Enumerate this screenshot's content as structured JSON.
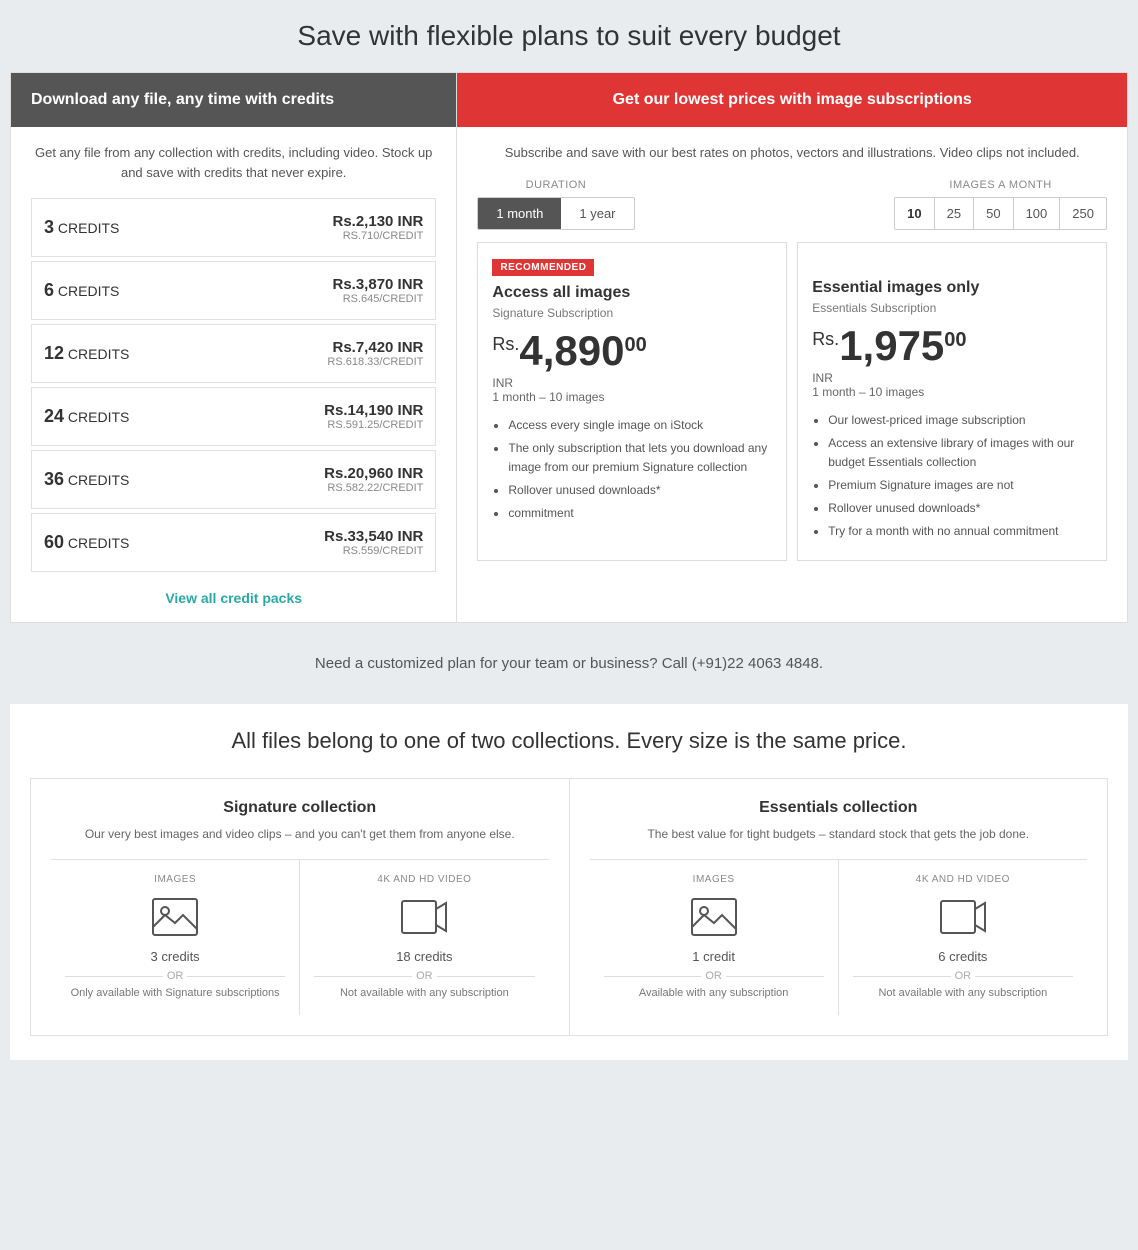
{
  "page": {
    "main_title": "Save with flexible plans to suit every budget"
  },
  "credits_panel": {
    "header": "Download any file, any time with credits",
    "description": "Get any file from any collection with credits, including video. Stock up and save with credits that never expire.",
    "rows": [
      {
        "count": "3",
        "label": "CREDITS",
        "price": "Rs.2,130 INR",
        "per_credit": "RS.710/CREDIT"
      },
      {
        "count": "6",
        "label": "CREDITS",
        "price": "Rs.3,870 INR",
        "per_credit": "RS.645/CREDIT"
      },
      {
        "count": "12",
        "label": "CREDITS",
        "price": "Rs.7,420 INR",
        "per_credit": "RS.618.33/CREDIT"
      },
      {
        "count": "24",
        "label": "CREDITS",
        "price": "Rs.14,190 INR",
        "per_credit": "RS.591.25/CREDIT"
      },
      {
        "count": "36",
        "label": "CREDITS",
        "price": "Rs.20,960 INR",
        "per_credit": "RS.582.22/CREDIT"
      },
      {
        "count": "60",
        "label": "CREDITS",
        "price": "Rs.33,540 INR",
        "per_credit": "RS.559/CREDIT"
      }
    ],
    "view_all_link": "View all credit packs"
  },
  "subs_panel": {
    "header": "Get our lowest prices with image subscriptions",
    "description": "Subscribe and save with our best rates on photos, vectors and illustrations. Video clips not included.",
    "duration_label": "DURATION",
    "duration_options": [
      "1 month",
      "1 year"
    ],
    "duration_active": "1 month",
    "images_label": "IMAGES A MONTH",
    "images_options": [
      "10",
      "25",
      "50",
      "100",
      "250"
    ],
    "images_active": "10",
    "cards": [
      {
        "recommended": true,
        "recommended_label": "RECOMMENDED",
        "title": "Access all images",
        "subtitle": "Signature Subscription",
        "price_rs": "Rs.",
        "price_main": "4,890",
        "price_decimal": "00",
        "price_currency": "INR",
        "price_duration": "1 month – 10 images",
        "features": [
          "Access every single image on iStock",
          "The only subscription that lets you download any image from our premium Signature collection",
          "Rollover unused downloads*",
          "commitment"
        ]
      },
      {
        "recommended": false,
        "title": "Essential images only",
        "subtitle": "Essentials Subscription",
        "price_rs": "Rs.",
        "price_main": "1,975",
        "price_decimal": "00",
        "price_currency": "INR",
        "price_duration": "1 month – 10 images",
        "features": [
          "Our lowest-priced image subscription",
          "Access an extensive library of images with our budget Essentials collection",
          "Premium Signature images are not",
          "Rollover unused downloads*",
          "Try for a month with no annual commitment"
        ]
      }
    ]
  },
  "custom_plan": {
    "text": "Need a customized plan for your team or business? Call (+91)22 4063 4848."
  },
  "collections_section": {
    "title": "All files belong to one of two collections. Every size is the same price.",
    "collections": [
      {
        "title": "Signature collection",
        "description": "Our very best images and video clips – and you can't get them from anyone else.",
        "items": [
          {
            "type": "IMAGES",
            "icon": "image",
            "credits": "3 credits",
            "or": "OR",
            "note": "Only available with Signature subscriptions"
          },
          {
            "type": "4K AND HD VIDEO",
            "icon": "video",
            "credits": "18 credits",
            "or": "OR",
            "note": "Not available with any subscription"
          }
        ]
      },
      {
        "title": "Essentials collection",
        "description": "The best value for tight budgets – standard stock that gets the job done.",
        "items": [
          {
            "type": "IMAGES",
            "icon": "image",
            "credits": "1 credit",
            "or": "OR",
            "note": "Available with any subscription"
          },
          {
            "type": "4K AND HD VIDEO",
            "icon": "video",
            "credits": "6 credits",
            "or": "OR",
            "note": "Not available with any subscription"
          }
        ]
      }
    ]
  }
}
